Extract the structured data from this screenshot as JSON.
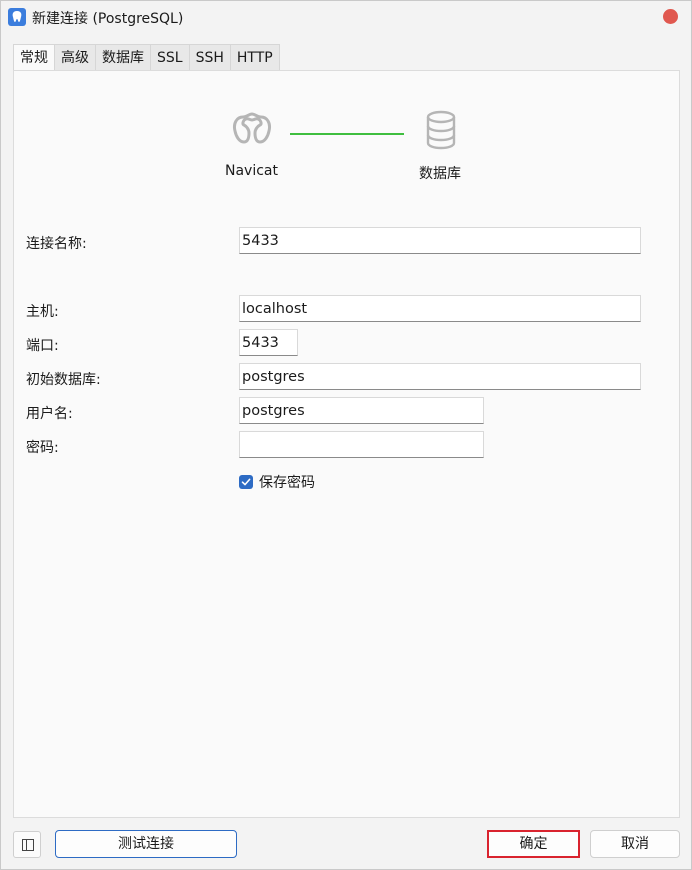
{
  "window": {
    "title": "新建连接 (PostgreSQL)"
  },
  "tabs": [
    {
      "label": "常规",
      "active": true
    },
    {
      "label": "高级",
      "active": false
    },
    {
      "label": "数据库",
      "active": false
    },
    {
      "label": "SSL",
      "active": false
    },
    {
      "label": "SSH",
      "active": false
    },
    {
      "label": "HTTP",
      "active": false
    }
  ],
  "diagram": {
    "left_label": "Navicat",
    "right_label": "数据库",
    "left_icon": "navicat-logo-icon",
    "right_icon": "database-icon",
    "line_color": "#3fbe3f"
  },
  "form": {
    "connection_name": {
      "label": "连接名称:",
      "value": "5433"
    },
    "host": {
      "label": "主机:",
      "value": "localhost"
    },
    "port": {
      "label": "端口:",
      "value": "5433"
    },
    "initial_db": {
      "label": "初始数据库:",
      "value": "postgres"
    },
    "username": {
      "label": "用户名:",
      "value": "postgres"
    },
    "password": {
      "label": "密码:",
      "value": ""
    },
    "save_password": {
      "label": "保存密码",
      "checked": true
    }
  },
  "footer": {
    "test_label": "测试连接",
    "ok_label": "确定",
    "cancel_label": "取消"
  },
  "colors": {
    "accent": "#2d6bc4",
    "close": "#e0584f",
    "highlight": "#d9232e"
  }
}
